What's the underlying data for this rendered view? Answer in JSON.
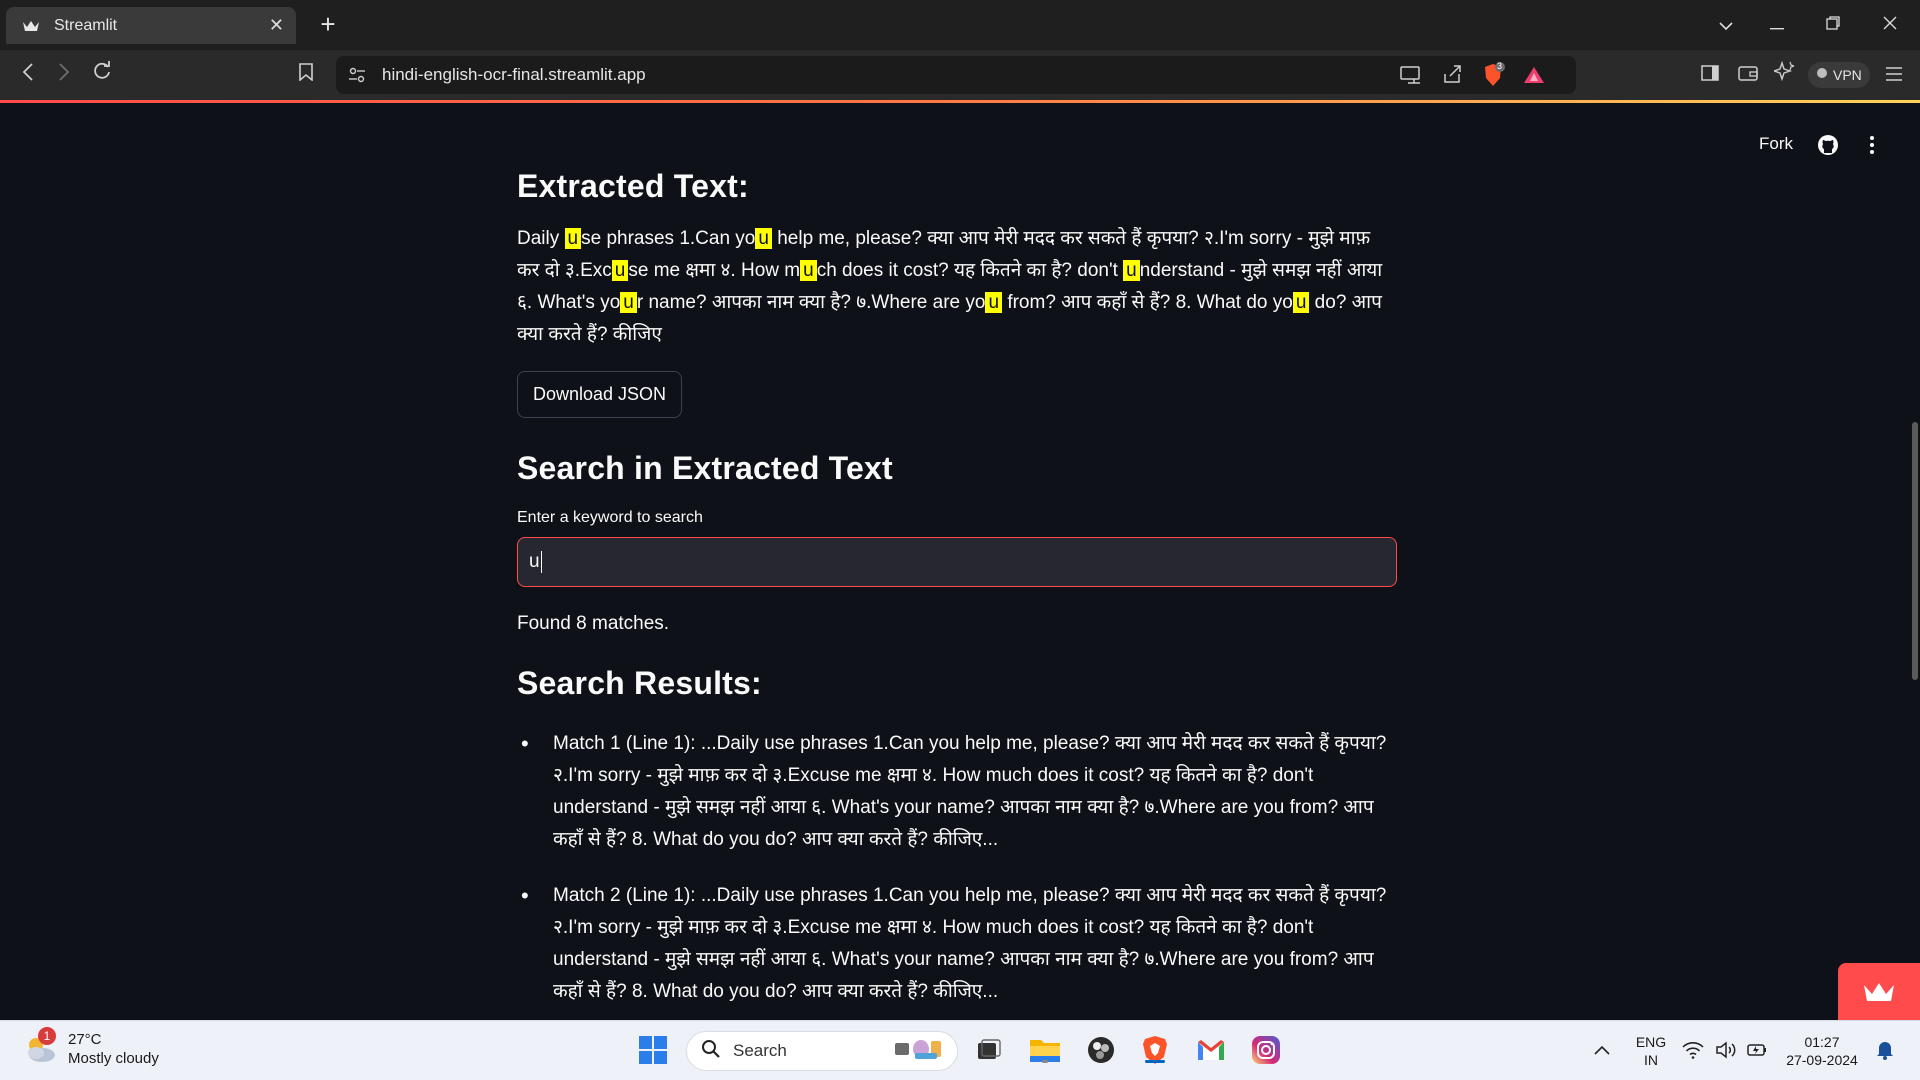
{
  "browser": {
    "tab_title": "Streamlit",
    "tab_close": "✕",
    "new_tab": "+",
    "url": "hindi-english-ocr-final.streamlit.app",
    "shield_count": "3",
    "vpn_label": "VPN"
  },
  "header": {
    "fork_label": "Fork"
  },
  "extracted": {
    "heading": "Extracted Text:",
    "segments": [
      "Daily ",
      "u",
      "se phrases 1.Can yo",
      "u",
      " help me, please? क्या आप मेरी मदद कर सकते हैं कृपया? २.I'm sorry - मुझे माफ़ कर दो ३.Exc",
      "u",
      "se me क्षमा ४. How m",
      "u",
      "ch does it cost? यह कितने का है? don't ",
      "u",
      "nderstand - मुझे समझ नहीं आया ६. What's yo",
      "u",
      "r name? आपका नाम क्या है? ७.Where are yo",
      "u",
      " from? आप कहाँ से हैं? 8. What do yo",
      "u",
      " do? आप क्या करते हैं? कीजिए"
    ],
    "download_label": "Download JSON"
  },
  "search": {
    "heading": "Search in Extracted Text",
    "input_label": "Enter a keyword to search",
    "input_value": "u",
    "found_text": "Found 8 matches.",
    "results_heading": "Search Results:",
    "results": [
      "Match 1 (Line 1): ...Daily use phrases 1.Can you help me, please? क्या आप मेरी मदद कर सकते हैं कृपया? २.I'm sorry - मुझे माफ़ कर दो ३.Excuse me क्षमा ४. How much does it cost? यह कितने का है? don't understand - मुझे समझ नहीं आया ६. What's your name? आपका नाम क्या है? ७.Where are you from? आप कहाँ से हैं? 8. What do you do? आप क्या करते हैं? कीजिए...",
      "Match 2 (Line 1): ...Daily use phrases 1.Can you help me, please? क्या आप मेरी मदद कर सकते हैं कृपया? २.I'm sorry - मुझे माफ़ कर दो ३.Excuse me क्षमा ४. How much does it cost? यह कितने का है? don't understand - मुझे समझ नहीं आया ६. What's your name? आपका नाम क्या है? ७.Where are you from? आप कहाँ से हैं? 8. What do you do? आप क्या करते हैं? कीजिए..."
    ]
  },
  "taskbar": {
    "temperature": "27°C",
    "condition": "Mostly cloudy",
    "weather_badge": "1",
    "search_label": "Search",
    "lang_top": "ENG",
    "lang_bottom": "IN",
    "time": "01:27",
    "date": "27-09-2024"
  },
  "colors": {
    "accent": "#ff4b4b",
    "highlight": "#ffff00",
    "background": "#0e1117"
  },
  "icons": [
    "streamlit-crown-icon",
    "back-icon",
    "forward-icon",
    "reload-icon",
    "bookmark-icon",
    "site-settings-icon",
    "cast-icon",
    "share-icon",
    "brave-shield-icon",
    "brave-rewards-icon",
    "sidebar-icon",
    "wallet-icon",
    "leo-ai-icon",
    "vpn-icon",
    "menu-icon",
    "github-icon",
    "kebab-icon",
    "windows-start-icon",
    "search-icon",
    "task-view-icon",
    "file-explorer-icon",
    "obs-icon",
    "brave-icon",
    "gmail-icon",
    "instagram-icon",
    "chevron-up-icon",
    "wifi-icon",
    "volume-icon",
    "battery-icon",
    "notification-bell-icon"
  ]
}
